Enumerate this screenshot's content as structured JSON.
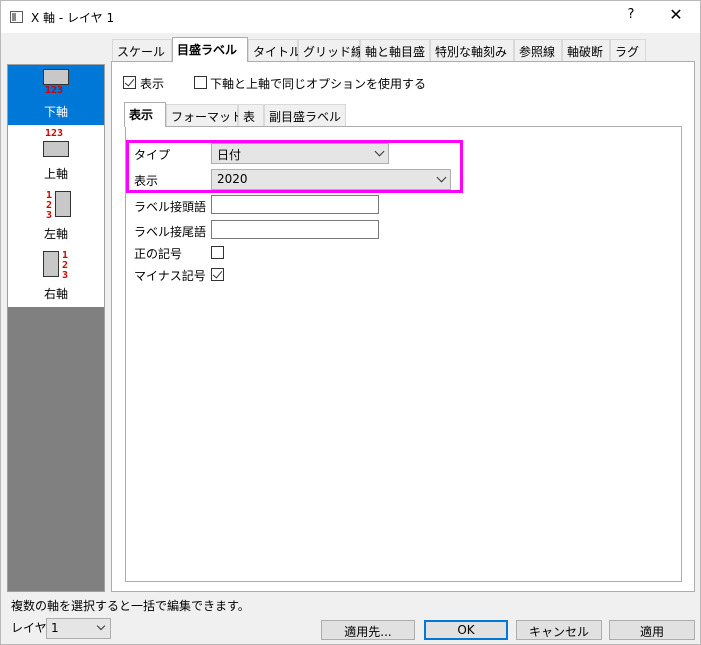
{
  "window": {
    "title": "X 軸 - レイヤ 1",
    "help": "?",
    "close": "✕"
  },
  "axes": [
    {
      "label": "下軸",
      "selected": true,
      "icon": "bottom-axis-icon",
      "numbers": "123"
    },
    {
      "label": "上軸",
      "selected": false,
      "icon": "top-axis-icon",
      "numbers": "123"
    },
    {
      "label": "左軸",
      "selected": false,
      "icon": "left-axis-icon",
      "numbers": "123"
    },
    {
      "label": "右軸",
      "selected": false,
      "icon": "right-axis-icon",
      "numbers": "123"
    }
  ],
  "tabs": [
    "スケール",
    "目盛ラベル",
    "タイトル",
    "グリッド線",
    "軸と軸目盛",
    "特別な軸刻み",
    "参照線",
    "軸破断",
    "ラグ"
  ],
  "active_tab": "目盛ラベル",
  "options": {
    "show_label": "表示",
    "show_checked": true,
    "same_as_top": "下軸と上軸で同じオプションを使用する",
    "same_checked": false
  },
  "subtabs": [
    "表示",
    "フォーマット",
    "表",
    "副目盛ラベル"
  ],
  "active_subtab": "表示",
  "form": {
    "type_label": "タイプ",
    "type_value": "日付",
    "display_label": "表示",
    "display_value": "2020",
    "prefix_label": "ラベル接頭語",
    "prefix_value": "",
    "suffix_label": "ラベル接尾語",
    "suffix_value": "",
    "plus_sign_label": "正の記号",
    "plus_sign_checked": false,
    "minus_sign_label": "マイナス記号",
    "minus_sign_checked": true
  },
  "status": "複数の軸を選択すると一括で編集できます。",
  "layer": {
    "label": "レイヤ",
    "value": "1"
  },
  "buttons": {
    "apply_to": "適用先...",
    "ok": "OK",
    "cancel": "キャンセル",
    "apply": "適用"
  },
  "colors": {
    "accent": "#0078d7",
    "highlight": "#ff00ff",
    "axis_numbers": "#d40000"
  }
}
